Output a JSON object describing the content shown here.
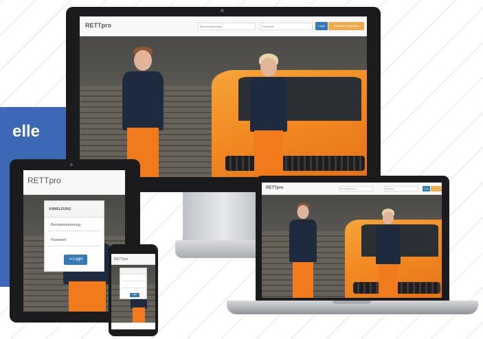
{
  "banner": {
    "text": "elle",
    "color": "#3d68b6"
  },
  "brand": "RETTpro",
  "desktop_nav": {
    "username_placeholder": "Benutzerkennung",
    "password_placeholder": "Passwort",
    "login_label": "Login",
    "forgot_label": "Passwort vergessen"
  },
  "tablet_login": {
    "header": "ANMELDUNG",
    "username_label": "Benutzerkennung",
    "password_label": "Passwort",
    "login_label": "Login"
  },
  "phone_login": {
    "login_label": "Login"
  },
  "colors": {
    "primary_button": "#337ab7",
    "warning_button": "#f0ad4e",
    "van_orange": "#f28a22",
    "uniform_navy": "#1e2a3d"
  },
  "icons": {
    "login_icon": "login-arrow-icon"
  }
}
